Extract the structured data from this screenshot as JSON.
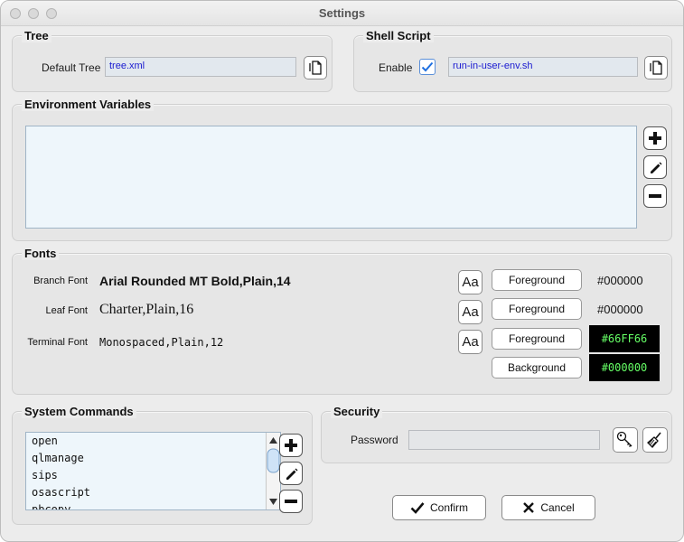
{
  "window": {
    "title": "Settings"
  },
  "tree": {
    "legend": "Tree",
    "default_tree_label": "Default Tree",
    "default_tree_value": "tree.xml"
  },
  "shell_script": {
    "legend": "Shell Script",
    "enable_label": "Enable",
    "enabled": true,
    "script_value": "run-in-user-env.sh"
  },
  "env_vars": {
    "legend": "Environment Variables"
  },
  "fonts": {
    "legend": "Fonts",
    "rows": [
      {
        "label": "Branch Font",
        "value": "Arial Rounded MT Bold,Plain,14",
        "color_button": "Foreground",
        "color": "#000000"
      },
      {
        "label": "Leaf Font",
        "value": "Charter,Plain,16",
        "color_button": "Foreground",
        "color": "#000000"
      },
      {
        "label": "Terminal Font",
        "value": "Monospaced,Plain,12",
        "color_button": "Foreground",
        "color": "#66FF66"
      }
    ],
    "terminal_background_button": "Background",
    "terminal_background": "#000000",
    "font_icon_glyph": "Aa"
  },
  "system_commands": {
    "legend": "System Commands",
    "items": [
      "open",
      "qlmanage",
      "sips",
      "osascript",
      "pbcopy"
    ]
  },
  "security": {
    "legend": "Security",
    "password_label": "Password",
    "password_value": ""
  },
  "actions": {
    "confirm_label": "Confirm",
    "cancel_label": "Cancel"
  },
  "colors": {
    "terminal_fg": "#66FF66",
    "terminal_bg": "#000000",
    "field_text": "#1a1ad0",
    "checkbox_accent": "#1e6fe0"
  }
}
